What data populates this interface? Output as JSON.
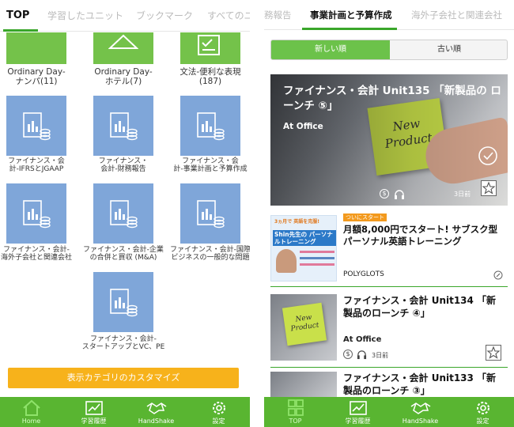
{
  "left": {
    "tabs": [
      "TOP",
      "学習したユニット",
      "ブックマーク",
      "すべてのユ"
    ],
    "tiles": [
      {
        "label": "Ordinary Day-\nナンパ(11)",
        "color": "green"
      },
      {
        "label": "Ordinary Day-\nホテル(7)",
        "color": "green"
      },
      {
        "label": "文法-便利な表現\n(187)",
        "color": "green"
      },
      {
        "label": "ファイナンス・会\n計-IFRSとJGAAP",
        "color": "blue"
      },
      {
        "label": "ファイナンス・\n会計-財務報告",
        "color": "blue"
      },
      {
        "label": "ファイナンス・会\n計-事業計画と予算作成",
        "color": "blue"
      },
      {
        "label": "ファイナンス・会計-\n海外子会社と関連会社",
        "color": "blue"
      },
      {
        "label": "ファイナンス・会計-企業\nの合併と買収 (M&A)",
        "color": "blue"
      },
      {
        "label": "ファイナンス・会計-国際\nビジネスの一般的な問題",
        "color": "blue"
      },
      {
        "label": "ファイナンス・会計-\nスタートアップとVC、PE",
        "color": "blue"
      }
    ],
    "customize_label": "表示カテゴリのカスタマイズ",
    "nav": [
      {
        "label": "Home",
        "icon": "home-icon"
      },
      {
        "label": "学習履歴",
        "icon": "chart-icon"
      },
      {
        "label": "HandShake",
        "icon": "handshake-icon"
      },
      {
        "label": "設定",
        "icon": "gear-icon"
      }
    ]
  },
  "right": {
    "tabs": [
      "務報告",
      "事業計画と予算作成",
      "海外子会社と関連会社"
    ],
    "sort": {
      "newest": "新しい順",
      "oldest": "古い順"
    },
    "hero": {
      "title": "ファイナンス・会計 Unit135 「新製品の ローンチ ⑤」",
      "source": "At Office",
      "date": "3日前",
      "sticky_text": "New Product"
    },
    "ad": {
      "badge": "ついにスタート",
      "title": "月額8,000円でスタート! サブスク型パーソナル英語トレーニング",
      "source": "POLYGLOTS",
      "thumb_heading": "Shin先生の パーソナルトレーニング",
      "thumb_top": "3ヵ月で 英語を克服!"
    },
    "items": [
      {
        "title": "ファイナンス・会計 Unit134 「新製品のローンチ ④」",
        "source": "At Office",
        "date": "3日前"
      },
      {
        "title": "ファイナンス・会計 Unit133 「新製品のローンチ ③」",
        "source": "",
        "date": ""
      }
    ],
    "nav": [
      {
        "label": "TOP",
        "icon": "grid-icon"
      },
      {
        "label": "学習履歴",
        "icon": "chart-icon"
      },
      {
        "label": "HandShake",
        "icon": "handshake-icon"
      },
      {
        "label": "設定",
        "icon": "gear-icon"
      }
    ]
  },
  "colors": {
    "accent": "#59b531",
    "tile_blue": "#7fa6d9",
    "tile_green": "#74c24a",
    "customize": "#f7b21b"
  }
}
